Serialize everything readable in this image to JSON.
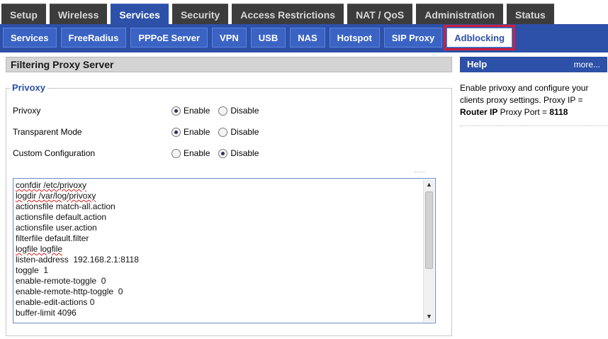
{
  "top_tabs": [
    {
      "label": "Setup"
    },
    {
      "label": "Wireless"
    },
    {
      "label": "Services"
    },
    {
      "label": "Security"
    },
    {
      "label": "Access Restrictions"
    },
    {
      "label": "NAT / QoS"
    },
    {
      "label": "Administration"
    },
    {
      "label": "Status"
    }
  ],
  "active_top_tab": "Services",
  "sub_tabs": [
    {
      "label": "Services"
    },
    {
      "label": "FreeRadius"
    },
    {
      "label": "PPPoE Server"
    },
    {
      "label": "VPN"
    },
    {
      "label": "USB"
    },
    {
      "label": "NAS"
    },
    {
      "label": "Hotspot"
    },
    {
      "label": "SIP Proxy"
    },
    {
      "label": "Adblocking"
    }
  ],
  "active_sub_tab": "Adblocking",
  "section": {
    "title": "Filtering Proxy Server",
    "legend": "Privoxy"
  },
  "settings": [
    {
      "label": "Privoxy",
      "options": [
        "Enable",
        "Disable"
      ],
      "selected": "Enable"
    },
    {
      "label": "Transparent Mode",
      "options": [
        "Enable",
        "Disable"
      ],
      "selected": "Enable"
    },
    {
      "label": "Custom Configuration",
      "options": [
        "Enable",
        "Disable"
      ],
      "selected": "Disable"
    }
  ],
  "config_lines": [
    "confdir /etc/privoxy",
    "logdir /var/log/privoxy",
    "actionsfile match-all.action",
    "actionsfile default.action",
    "actionsfile user.action",
    "filterfile default.filter",
    "logfile logfile",
    "listen-address  192.168.2.1:8118",
    "toggle  1",
    "enable-remote-toggle  0",
    "enable-remote-http-toggle  0",
    "enable-edit-actions 0",
    "buffer-limit 4096"
  ],
  "help": {
    "title": "Help",
    "more": "more...",
    "text_1": "Enable privoxy and configure your clients proxy settings. Proxy IP = ",
    "router_ip": "Router IP",
    "text_2": " Proxy Port = ",
    "port": "8118"
  },
  "colors": {
    "primary": "#2d50a8",
    "tab_dark": "#3c3c3c",
    "highlight_border": "#d0203a"
  }
}
